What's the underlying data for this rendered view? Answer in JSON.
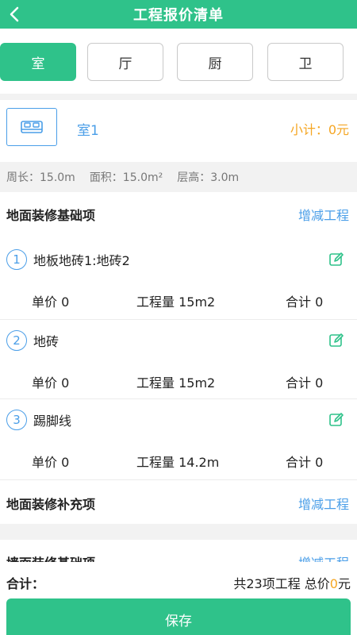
{
  "header": {
    "title": "工程报价清单",
    "back_icon": "chevron-left-icon"
  },
  "tabs": [
    {
      "label": "室",
      "active": true
    },
    {
      "label": "厅",
      "active": false
    },
    {
      "label": "厨",
      "active": false
    },
    {
      "label": "卫",
      "active": false
    }
  ],
  "room": {
    "icon": "bed-icon",
    "name": "室1",
    "subtotal": "小计：0元"
  },
  "dims": {
    "perimeter": "周长：15.0m",
    "area": "面积：15.0m²",
    "height": "层高：3.0m"
  },
  "sections": [
    {
      "title": "地面装修基础项",
      "link": "增减工程",
      "items": [
        {
          "num": "1",
          "name": "地板地砖1:地砖2",
          "price": "单价 0",
          "quantity": "工程量 15m2",
          "total": "合计 0"
        },
        {
          "num": "2",
          "name": "地砖",
          "price": "单价 0",
          "quantity": "工程量 15m2",
          "total": "合计 0"
        },
        {
          "num": "3",
          "name": "踢脚线",
          "price": "单价 0",
          "quantity": "工程量 14.2m",
          "total": "合计 0"
        }
      ]
    },
    {
      "title": "地面装修补充项",
      "link": "增减工程"
    },
    {
      "title": "墙面装修基础项",
      "link": "增减工程"
    }
  ],
  "footer": {
    "sum_label": "合计：",
    "summary_prefix": "共23项工程  总价",
    "total_value": "0",
    "unit": "元",
    "save_label": "保存"
  },
  "colors": {
    "primary": "#2fc28a",
    "link": "#4a9ee8",
    "accent": "#f5a623"
  }
}
